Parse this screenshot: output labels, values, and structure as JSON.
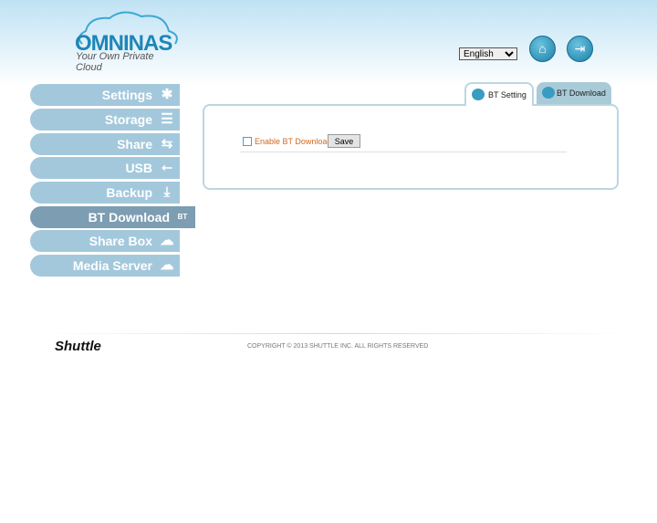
{
  "brand": {
    "name": "OMNINAS",
    "tagline": "Your Own Private Cloud"
  },
  "header": {
    "language": "English",
    "home_icon": "home-icon",
    "logout_icon": "logout-icon"
  },
  "nav": [
    {
      "label": "Settings",
      "icon": "✱"
    },
    {
      "label": "Storage",
      "icon": "☰"
    },
    {
      "label": "Share",
      "icon": "⇆"
    },
    {
      "label": "USB",
      "icon": "⭠"
    },
    {
      "label": "Backup",
      "icon": "⤓"
    },
    {
      "label": "BT Download",
      "icon": "BT"
    },
    {
      "label": "Share Box",
      "icon": "☁"
    },
    {
      "label": "Media Server",
      "icon": "☁"
    }
  ],
  "tabs": [
    {
      "label": "BT Setting"
    },
    {
      "label": "BT Download"
    }
  ],
  "form": {
    "enable_label": "Enable BT Download",
    "save_label": "Save"
  },
  "footer": {
    "brand": "Shuttle",
    "copyright": "COPYRIGHT © 2013 SHUTTLE INC.  ALL RIGHTS RESERVED"
  }
}
